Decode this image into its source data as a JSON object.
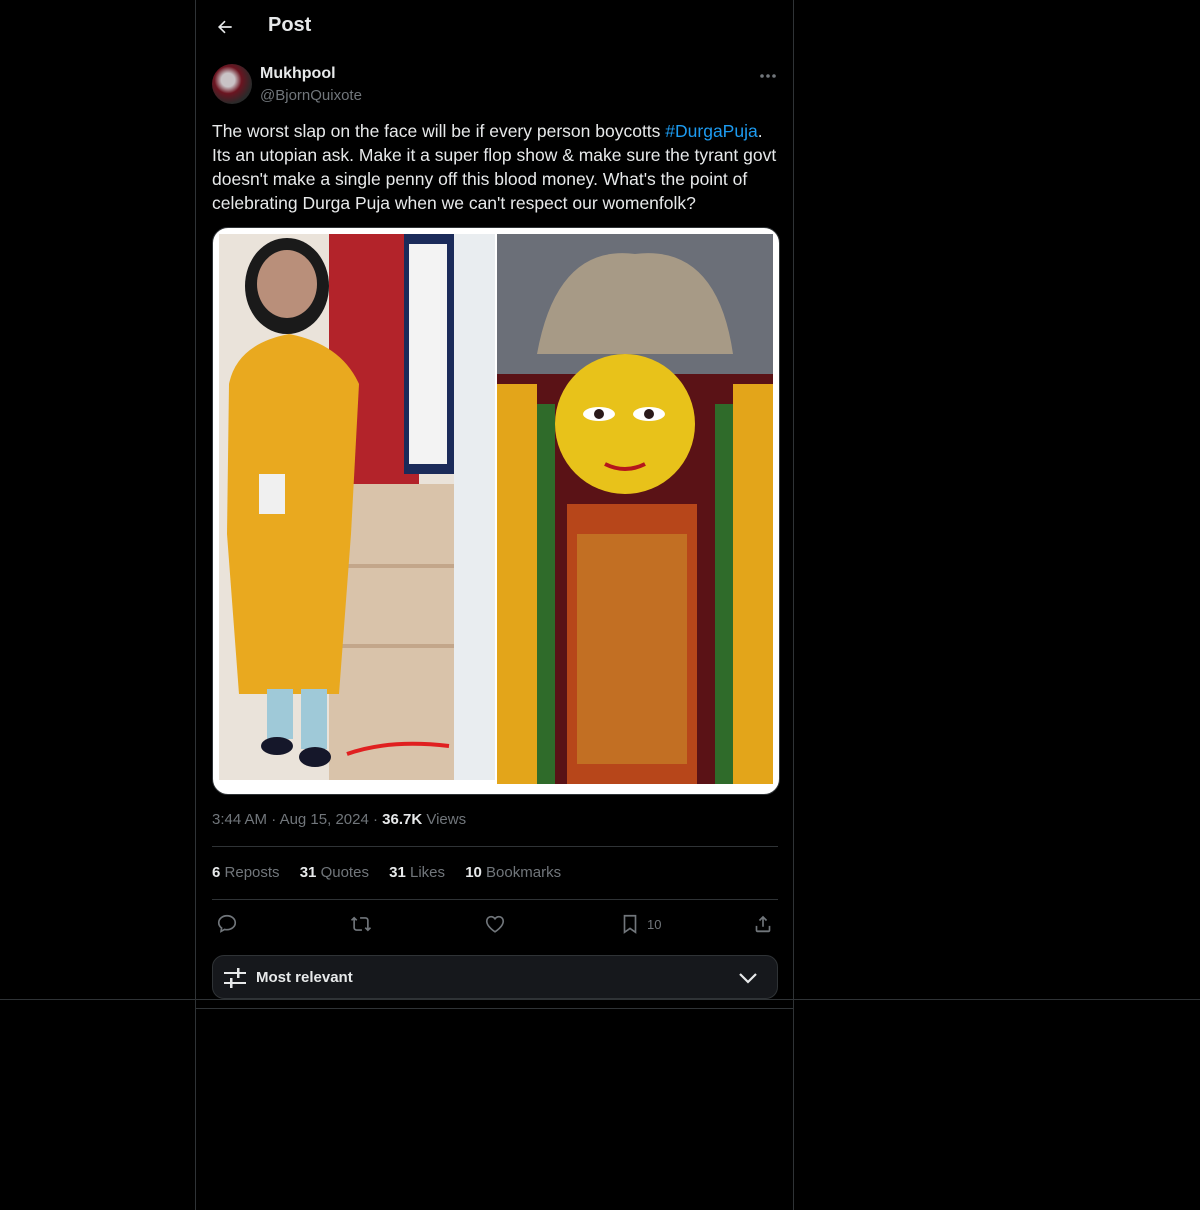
{
  "header": {
    "title": "Post"
  },
  "post": {
    "author_name": "Mukhpool",
    "author_handle": "@BjornQuixote",
    "text_before": "The worst slap on the face will be if every person boycotts ",
    "hashtag": "#DurgaPuja",
    "text_after": ". Its an utopian ask. Make it a super flop show & make sure the tyrant govt doesn't make a single penny off this blood money. What's the point of celebrating Durga Puja when we can't respect our womenfolk?",
    "time": "3:44 AM",
    "date": "Aug 15, 2024",
    "views_count": "36.7K",
    "views_label": "Views",
    "separator": "·"
  },
  "stats": {
    "reposts_count": "6",
    "reposts_label": "Reposts",
    "quotes_count": "31",
    "quotes_label": "Quotes",
    "likes_count": "31",
    "likes_label": "Likes",
    "bookmarks_count": "10",
    "bookmarks_label": "Bookmarks"
  },
  "actions": {
    "bookmark_count": "10",
    "icons": [
      "reply-icon",
      "repost-icon",
      "like-icon",
      "bookmark-icon",
      "share-icon"
    ]
  },
  "sort": {
    "label": "Most relevant"
  },
  "colors": {
    "accent": "#1d9bf0",
    "text": "#e7e9ea",
    "muted": "#71767b",
    "border": "#2f3336",
    "background": "#000000"
  }
}
